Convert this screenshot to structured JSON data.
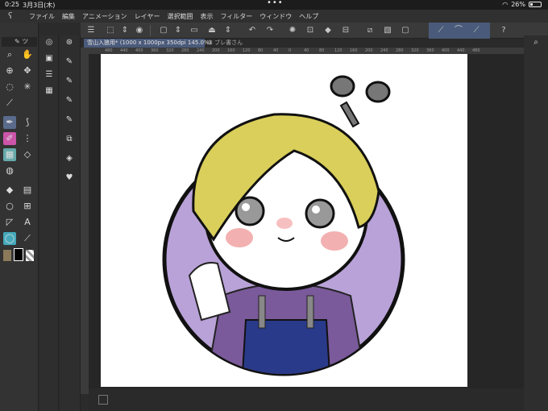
{
  "status": {
    "time": "0:25",
    "date": "3月3日(木)",
    "battery": "26%",
    "battery_level": 0.26
  },
  "menu": {
    "items": [
      "ファイル",
      "編集",
      "アニメーション",
      "レイヤー",
      "選択範囲",
      "表示",
      "フィルター",
      "ウィンドウ",
      "ヘルプ"
    ]
  },
  "tabs": {
    "active": "雪山入狼用* (1000 x 1000px 350dpi 145.0%)",
    "other": "ブレ書さん"
  },
  "ruler": {
    "marks": [
      "480",
      "440",
      "400",
      "360",
      "320",
      "280",
      "240",
      "200",
      "160",
      "120",
      "80",
      "40",
      "0",
      "40",
      "80",
      "120",
      "160",
      "200",
      "240",
      "280",
      "320",
      "360",
      "400",
      "440",
      "480"
    ]
  },
  "colors": {
    "main": "#000000",
    "sub": "#ffffff",
    "accent": "#4a5a7a",
    "hair": "#d9cf5a",
    "bg_circle": "#b9a2d8"
  },
  "icons": {
    "left": [
      "pen-icon",
      "hand-icon",
      "zoom-icon",
      "move-icon",
      "lasso-icon",
      "wand-icon",
      "eyedropper-icon",
      "brush-icon",
      "marker-icon",
      "fill-icon",
      "eraser-icon",
      "blend-icon",
      "gradient-icon",
      "shape-icon",
      "text-icon",
      "balloon-icon"
    ]
  }
}
